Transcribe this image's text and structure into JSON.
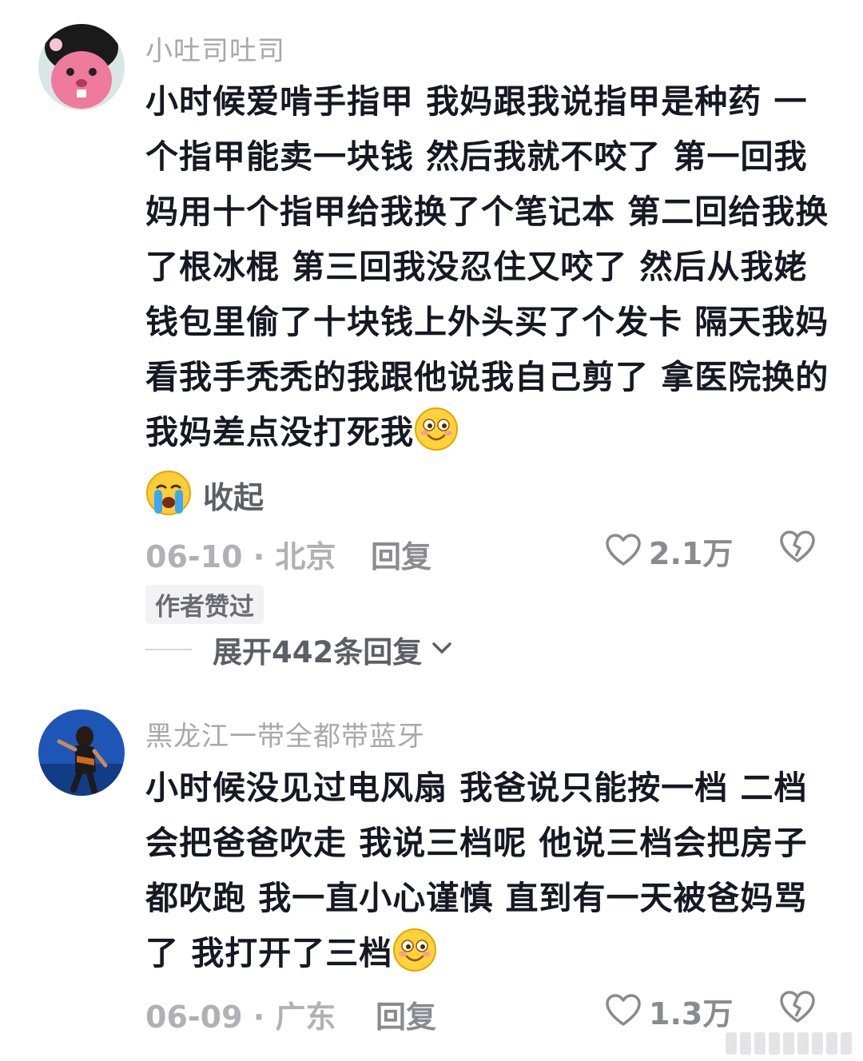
{
  "comments": [
    {
      "username": "小吐司吐司",
      "text": "小时候爱啃手指甲 我妈跟我说指甲是种药 一个指甲能卖一块钱 然后我就不咬了 第一回我妈用十个指甲给我换了个笔记本 第二回给我换了根冰棍 第三回我没忍住又咬了 然后从我姥钱包里偷了十块钱上外头买了个发卡 隔天我妈看我手秃秃的我跟他说我自己剪了 拿医院换的 我妈差点没打死我",
      "collapse_label": "收起",
      "date": "06-10 · 北京",
      "reply_label": "回复",
      "likes": "2.1万",
      "author_liked": "作者赞过",
      "expand_replies": "展开442条回复"
    },
    {
      "username": "黑龙江一带全都带蓝牙",
      "text": "小时候没见过电风扇 我爸说只能按一档 二档会把爸爸吹走 我说三档呢 他说三档会把房子都吹跑 我一直小心谨慎 直到有一天被爸妈骂了 我打开了三档",
      "date": "06-09 · 广东",
      "reply_label": "回复",
      "likes": "1.3万"
    }
  ],
  "colors": {
    "username": "#a8a8ad",
    "text": "#161823",
    "meta": "#8a8a91"
  }
}
